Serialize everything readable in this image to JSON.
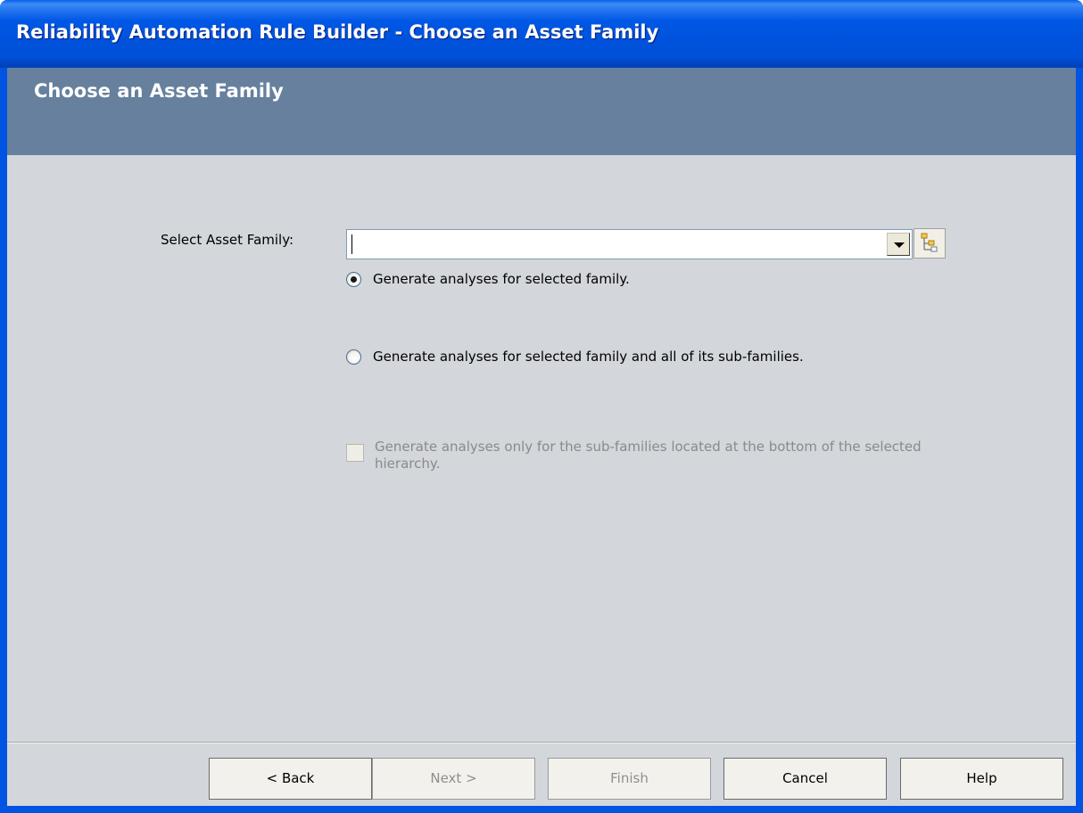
{
  "window": {
    "title": "Reliability Automation Rule Builder - Choose an Asset Family"
  },
  "header": {
    "title": "Choose an Asset Family"
  },
  "form": {
    "asset_family_label": "Select Asset Family:",
    "asset_family_value": "",
    "browse_icon": "hierarchy-browse-icon",
    "options": [
      {
        "label": "Generate analyses for selected family.",
        "selected": true
      },
      {
        "label": "Generate analyses for selected family and all of its sub-families.",
        "selected": false
      }
    ],
    "bottom_only_checkbox": {
      "label": "Generate analyses only for the sub-families located at the bottom of the selected hierarchy.",
      "checked": false,
      "enabled": false
    }
  },
  "buttons": {
    "back": "< Back",
    "next": "Next >",
    "finish": "Finish",
    "cancel": "Cancel",
    "help": "Help"
  },
  "colors": {
    "titlebar": "#0054e3",
    "header_band": "#66809e",
    "client_bg": "#d3d6da"
  }
}
